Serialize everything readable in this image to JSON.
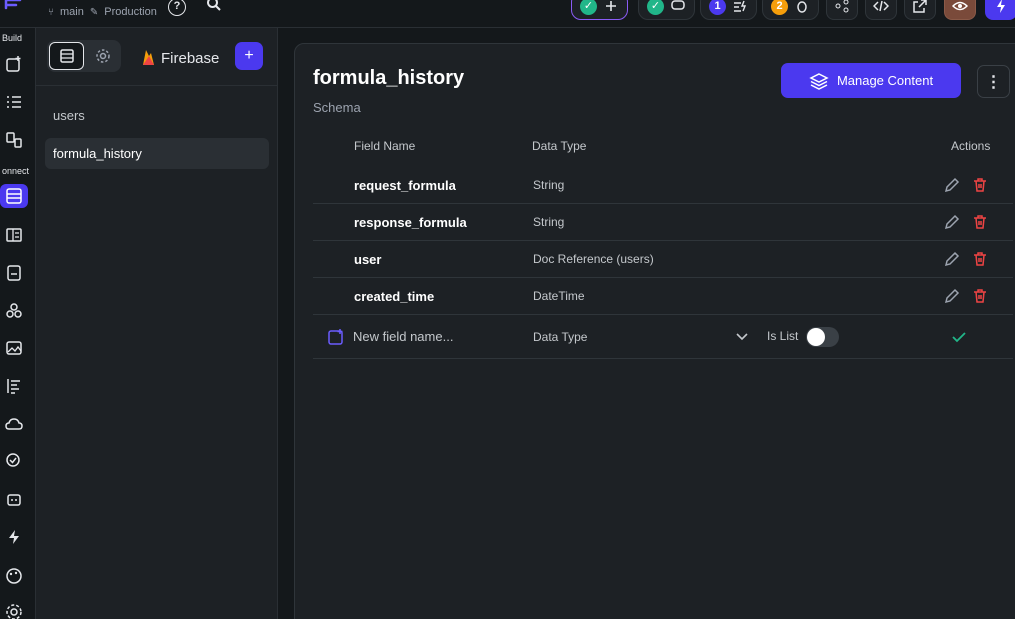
{
  "topbar": {
    "branch": "main",
    "environment": "Production",
    "help_label": "?",
    "badge_1": "1",
    "badge_2": "2",
    "colors": {
      "green": "#21b689",
      "purple": "#4b39ef",
      "orange": "#f59e0b",
      "preview": "#7a4a3a"
    }
  },
  "rail": {
    "build_label": "Build",
    "connect_label": "onnect"
  },
  "collections": {
    "provider": "Firebase",
    "add_label": "+",
    "items": [
      {
        "label": "users"
      },
      {
        "label": "formula_history"
      }
    ]
  },
  "main": {
    "title": "formula_history",
    "subtitle": "Schema",
    "manage_label": "Manage Content",
    "more_label": "⋮",
    "headers": {
      "field_name": "Field Name",
      "data_type": "Data Type",
      "actions": "Actions"
    },
    "fields": [
      {
        "name": "request_formula",
        "type": "String"
      },
      {
        "name": "response_formula",
        "type": "String"
      },
      {
        "name": "user",
        "type": "Doc Reference (users)"
      },
      {
        "name": "created_time",
        "type": "DateTime"
      }
    ],
    "new_field": {
      "placeholder": "New field name...",
      "data_type_label": "Data Type",
      "is_list_label": "Is List",
      "is_list": false
    }
  }
}
